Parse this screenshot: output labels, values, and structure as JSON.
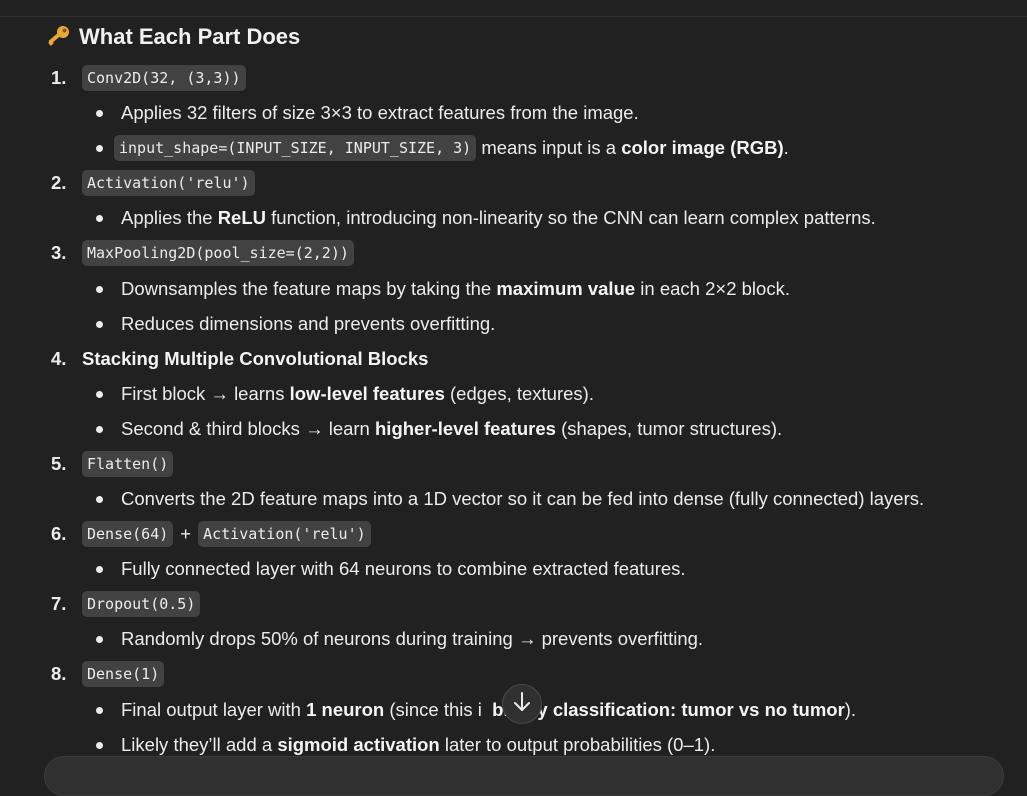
{
  "heading": {
    "icon": "key-icon",
    "text": "What Each Part Does"
  },
  "items": [
    {
      "number": "1.",
      "parts": [
        {
          "type": "code",
          "text": "Conv2D(32, (3,3))"
        }
      ],
      "bullets": [
        [
          {
            "t": "Applies 32 filters of size 3×3 to extract features from the image."
          }
        ],
        [
          {
            "code": "input_shape=(INPUT_SIZE, INPUT_SIZE, 3)"
          },
          {
            "t": " means input is a "
          },
          {
            "b": "color image (RGB)"
          },
          {
            "t": "."
          }
        ]
      ]
    },
    {
      "number": "2.",
      "parts": [
        {
          "type": "code",
          "text": "Activation('relu')"
        }
      ],
      "bullets": [
        [
          {
            "t": "Applies the "
          },
          {
            "b": "ReLU"
          },
          {
            "t": " function, introducing non-linearity so the CNN can learn complex patterns."
          }
        ]
      ]
    },
    {
      "number": "3.",
      "parts": [
        {
          "type": "code",
          "text": "MaxPooling2D(pool_size=(2,2))"
        }
      ],
      "bullets": [
        [
          {
            "t": "Downsamples the feature maps by taking the "
          },
          {
            "b": "maximum value"
          },
          {
            "t": " in each 2×2 block."
          }
        ],
        [
          {
            "t": "Reduces dimensions and prevents overfitting."
          }
        ]
      ]
    },
    {
      "number": "4.",
      "parts": [
        {
          "type": "bold",
          "text": "Stacking Multiple Convolutional Blocks"
        }
      ],
      "bullets": [
        [
          {
            "t": "First block → learns "
          },
          {
            "b": "low-level features"
          },
          {
            "t": " (edges, textures)."
          }
        ],
        [
          {
            "t": "Second & third blocks → learn "
          },
          {
            "b": "higher-level features"
          },
          {
            "t": " (shapes, tumor structures)."
          }
        ]
      ]
    },
    {
      "number": "5.",
      "parts": [
        {
          "type": "code",
          "text": "Flatten()"
        }
      ],
      "bullets": [
        [
          {
            "t": "Converts the 2D feature maps into a 1D vector so it can be fed into dense (fully connected) layers."
          }
        ]
      ]
    },
    {
      "number": "6.",
      "parts": [
        {
          "type": "code",
          "text": "Dense(64)"
        },
        {
          "type": "text",
          "text": "+"
        },
        {
          "type": "code",
          "text": "Activation('relu')"
        }
      ],
      "bullets": [
        [
          {
            "t": "Fully connected layer with 64 neurons to combine extracted features."
          }
        ]
      ]
    },
    {
      "number": "7.",
      "parts": [
        {
          "type": "code",
          "text": "Dropout(0.5)"
        }
      ],
      "bullets": [
        [
          {
            "t": "Randomly drops 50% of neurons during training → prevents overfitting."
          }
        ]
      ]
    },
    {
      "number": "8.",
      "parts": [
        {
          "type": "code",
          "text": "Dense(1)"
        }
      ],
      "bullets": [
        [
          {
            "t": "Final output layer with "
          },
          {
            "b": "1 neuron"
          },
          {
            "t": " (since this i"
          },
          {
            "t": "  "
          },
          {
            "b": "binary classification: tumor vs no tumor"
          },
          {
            "t": ")."
          }
        ],
        [
          {
            "t": "Likely they’ll add a "
          },
          {
            "b": "sigmoid activation"
          },
          {
            "t": " later to output probabilities (0–1)."
          }
        ]
      ]
    }
  ],
  "scroll_button": {
    "icon": "arrow-down-icon"
  },
  "colors": {
    "background": "#212121",
    "text": "#ececec",
    "code_bg": "#424242",
    "key": "#e0a030"
  }
}
